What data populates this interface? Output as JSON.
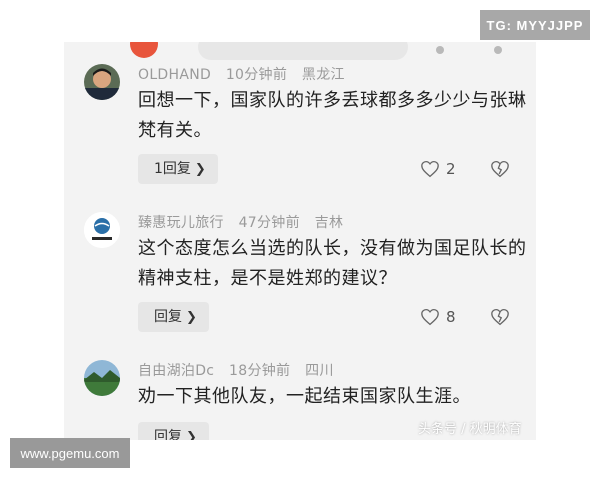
{
  "badges": {
    "top_right": "TG: MYYJJPP",
    "bottom_left": "www.pgemu.com",
    "watermark": "头条号 / 秋明体育"
  },
  "colors": {
    "page_bg": "#ffffff",
    "comment_bg": "#f3f3f3",
    "meta_text": "#9a9a9a",
    "body_text": "#222222",
    "button_bg": "#e6e6e6"
  },
  "comments": [
    {
      "user": "OLDHAND",
      "time": "10分钟前",
      "location": "黑龙江",
      "text": "回想一下，国家队的许多丢球都多多少少与张琳梵有关。",
      "reply_label": "1回复",
      "likes": "2",
      "avatar_icon": "avatar-man-photo"
    },
    {
      "user": "臻惠玩儿旅行",
      "time": "47分钟前",
      "location": "吉林",
      "text": "这个态度怎么当选的队长，没有做为国足队长的精神支柱，是不是姓郑的建议？",
      "reply_label": "回复",
      "likes": "8",
      "avatar_icon": "avatar-brand-logo"
    },
    {
      "user": "自由湖泊Dc",
      "time": "18分钟前",
      "location": "四川",
      "text": "劝一下其他队友，一起结束国家队生涯。",
      "reply_label": "回复",
      "avatar_icon": "avatar-landscape-photo"
    }
  ],
  "icons": {
    "reply_chevron": "chevron-right-icon",
    "like": "heart-icon",
    "dislike": "broken-heart-icon"
  }
}
